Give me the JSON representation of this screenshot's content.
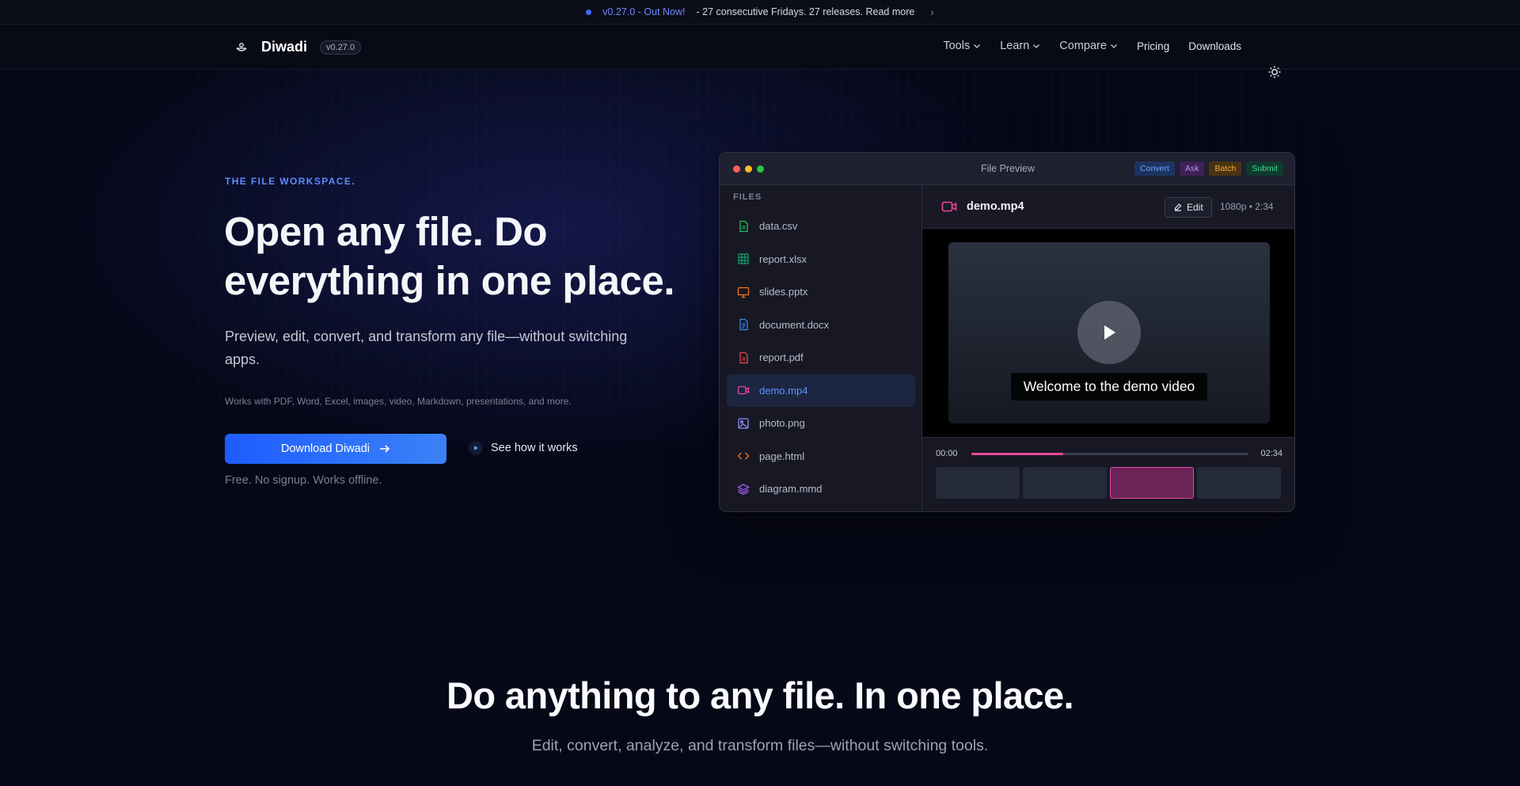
{
  "announcement": {
    "version": "v0.27.0 - Out Now!",
    "message": "- 27 consecutive Fridays. 27 releases. Read more",
    "chevron": "›"
  },
  "nav": {
    "brand": "Diwadi",
    "version": "v0.27.0",
    "items": [
      {
        "label": "Tools",
        "dropdown": true
      },
      {
        "label": "Learn",
        "dropdown": true
      },
      {
        "label": "Compare",
        "dropdown": true
      },
      {
        "label": "Pricing",
        "dropdown": false
      },
      {
        "label": "Downloads",
        "dropdown": false
      }
    ],
    "theme_icon": "sun-icon"
  },
  "hero": {
    "eyebrow": "THE FILE WORKSPACE.",
    "title_line1": "Open any file. Do",
    "title_line2": "everything in one place.",
    "subtitle": "Preview, edit, convert, and transform any file—without switching apps.",
    "works_with": "Works with PDF, Word, Excel, images, video, Markdown, presentations, and more.",
    "primary_cta": "Download Diwadi",
    "primary_cta_icon": "arrow-right-icon",
    "secondary_cta": "See how it works",
    "note": "Free. No signup. Works offline."
  },
  "preview": {
    "window_title": "File Preview",
    "tags": [
      {
        "label": "Convert",
        "bg": "#1d3461",
        "fg": "#6ea1ff"
      },
      {
        "label": "Ask",
        "bg": "#3f2156",
        "fg": "#c58cff"
      },
      {
        "label": "Batch",
        "bg": "#4a3212",
        "fg": "#f5b13d"
      },
      {
        "label": "Submit",
        "bg": "#0f3b2e",
        "fg": "#3ddc97"
      }
    ],
    "files_label": "FILES",
    "files": [
      {
        "name": "data.csv",
        "icon": "file-csv-icon",
        "color": "#22c55e",
        "active": false
      },
      {
        "name": "report.xlsx",
        "icon": "spreadsheet-icon",
        "color": "#16a36a",
        "active": false
      },
      {
        "name": "slides.pptx",
        "icon": "presentation-icon",
        "color": "#f97316",
        "active": false
      },
      {
        "name": "document.docx",
        "icon": "document-icon",
        "color": "#3b82f6",
        "active": false
      },
      {
        "name": "report.pdf",
        "icon": "pdf-icon",
        "color": "#ef4444",
        "active": false
      },
      {
        "name": "demo.mp4",
        "icon": "video-icon",
        "color": "#ec4899",
        "active": true
      },
      {
        "name": "photo.png",
        "icon": "image-icon",
        "color": "#8b8cf7",
        "active": false
      },
      {
        "name": "page.html",
        "icon": "code-icon",
        "color": "#f97316",
        "active": false
      },
      {
        "name": "diagram.mmd",
        "icon": "layers-icon",
        "color": "#a855f7",
        "active": false
      }
    ],
    "viewer": {
      "file_name": "demo.mp4",
      "edit_label": "Edit",
      "meta": "1080p • 2:34",
      "caption": "Welcome to the demo video",
      "time_start": "00:00",
      "time_end": "02:34",
      "progress": 0.33,
      "selected_thumb": 3
    }
  },
  "section2": {
    "title": "Do anything to any file. In one place.",
    "subtitle": "Edit, convert, analyze, and transform files—without switching tools."
  }
}
